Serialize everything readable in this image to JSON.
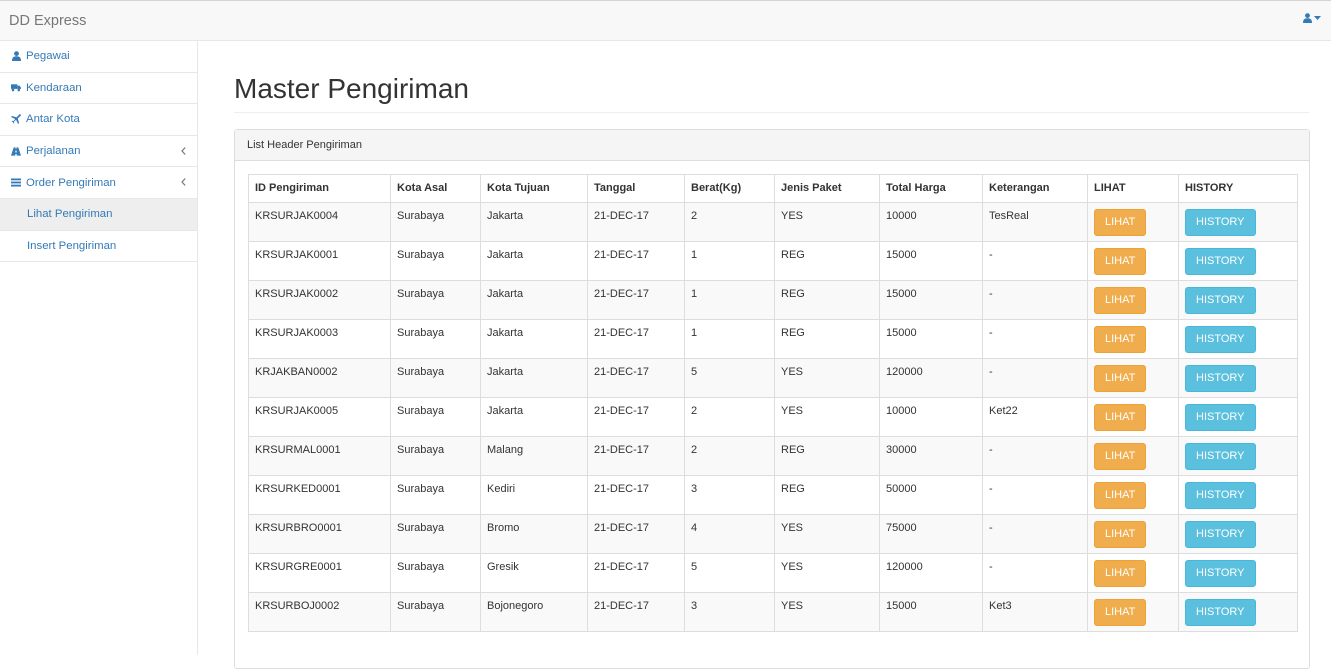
{
  "app": {
    "brand": "DD Express"
  },
  "sidebar": {
    "items": [
      {
        "label": "Pegawai",
        "icon": "user-icon"
      },
      {
        "label": "Kendaraan",
        "icon": "truck-icon"
      },
      {
        "label": "Antar Kota",
        "icon": "plane-icon"
      },
      {
        "label": "Perjalanan",
        "icon": "road-icon",
        "expandable": true
      },
      {
        "label": "Order Pengiriman",
        "icon": "list-icon",
        "expandable": true
      }
    ],
    "sub_items": [
      {
        "label": "Lihat Pengiriman",
        "active": true
      },
      {
        "label": "Insert Pengiriman",
        "active": false
      }
    ]
  },
  "main": {
    "title": "Master Pengiriman",
    "panel_title": "List Header Pengiriman",
    "table": {
      "headers": [
        "ID Pengiriman",
        "Kota Asal",
        "Kota Tujuan",
        "Tanggal",
        "Berat(Kg)",
        "Jenis Paket",
        "Total Harga",
        "Keterangan",
        "LIHAT",
        "HISTORY"
      ],
      "rows": [
        [
          "KRSURJAK0004",
          "Surabaya",
          "Jakarta",
          "21-DEC-17",
          "2",
          "YES",
          "10000",
          "TesReal"
        ],
        [
          "KRSURJAK0001",
          "Surabaya",
          "Jakarta",
          "21-DEC-17",
          "1",
          "REG",
          "15000",
          "-"
        ],
        [
          "KRSURJAK0002",
          "Surabaya",
          "Jakarta",
          "21-DEC-17",
          "1",
          "REG",
          "15000",
          "-"
        ],
        [
          "KRSURJAK0003",
          "Surabaya",
          "Jakarta",
          "21-DEC-17",
          "1",
          "REG",
          "15000",
          "-"
        ],
        [
          "KRJAKBAN0002",
          "Surabaya",
          "Jakarta",
          "21-DEC-17",
          "5",
          "YES",
          "120000",
          "-"
        ],
        [
          "KRSURJAK0005",
          "Surabaya",
          "Jakarta",
          "21-DEC-17",
          "2",
          "YES",
          "10000",
          "Ket22"
        ],
        [
          "KRSURMAL0001",
          "Surabaya",
          "Malang",
          "21-DEC-17",
          "2",
          "REG",
          "30000",
          "-"
        ],
        [
          "KRSURKED0001",
          "Surabaya",
          "Kediri",
          "21-DEC-17",
          "3",
          "REG",
          "50000",
          "-"
        ],
        [
          "KRSURBRO0001",
          "Surabaya",
          "Bromo",
          "21-DEC-17",
          "4",
          "YES",
          "75000",
          "-"
        ],
        [
          "KRSURGRE0001",
          "Surabaya",
          "Gresik",
          "21-DEC-17",
          "5",
          "YES",
          "120000",
          "-"
        ],
        [
          "KRSURBOJ0002",
          "Surabaya",
          "Bojonegoro",
          "21-DEC-17",
          "3",
          "YES",
          "15000",
          "Ket3"
        ]
      ],
      "button_lihat": "LIHAT",
      "button_history": "HISTORY"
    }
  },
  "colors": {
    "link": "#337ab7",
    "warning": "#f0ad4e",
    "info": "#5bc0de"
  }
}
